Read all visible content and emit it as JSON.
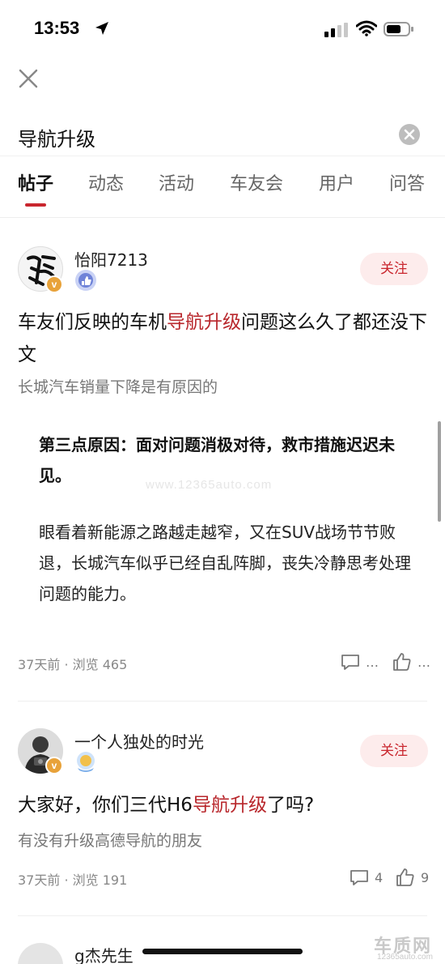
{
  "status_bar": {
    "time": "13:53"
  },
  "search": {
    "query": "导航升级"
  },
  "tabs": [
    {
      "label": "帖子"
    },
    {
      "label": "动态"
    },
    {
      "label": "活动"
    },
    {
      "label": "车友会"
    },
    {
      "label": "用户"
    },
    {
      "label": "问答"
    }
  ],
  "posts": [
    {
      "username": "怡阳7213",
      "follow_label": "关注",
      "title_prefix": "车友们反映的车机",
      "title_highlight": "导航升级",
      "title_suffix": "问题这么久了都还没下文",
      "subtitle": "长城汽车销量下降是有原因的",
      "quote_bold": "第三点原因：面对问题消极对待，救市措施迟迟未见。",
      "quote_body": "眼看着新能源之路越走越窄，又在SUV战场节节败退，长城汽车似乎已经自乱阵脚，丧失冷静思考处理问题的能力。",
      "meta": "37天前 · 浏览 465",
      "comments": "…",
      "likes": "…"
    },
    {
      "username": "一个人独处的时光",
      "follow_label": "关注",
      "title_prefix": "大家好，你们三代H6",
      "title_highlight": "导航升级",
      "title_suffix": "了吗?",
      "subtitle": "有没有升级高德导航的朋友",
      "meta": "37天前 · 浏览 191",
      "comments": "4",
      "likes": "9"
    },
    {
      "username": "g杰先生"
    }
  ],
  "watermark": "www.12365auto.com",
  "logo": {
    "main": "车质网",
    "sub": "12365auto.com"
  },
  "colors": {
    "accent": "#c9262e",
    "highlight": "#b8262b",
    "follow_bg": "#fdecec"
  },
  "icons": [
    "location-arrow-icon",
    "signal-icon",
    "wifi-icon",
    "battery-icon",
    "close-icon",
    "clear-icon",
    "comment-icon",
    "like-icon",
    "verified-v-icon",
    "level-badge-icon"
  ]
}
